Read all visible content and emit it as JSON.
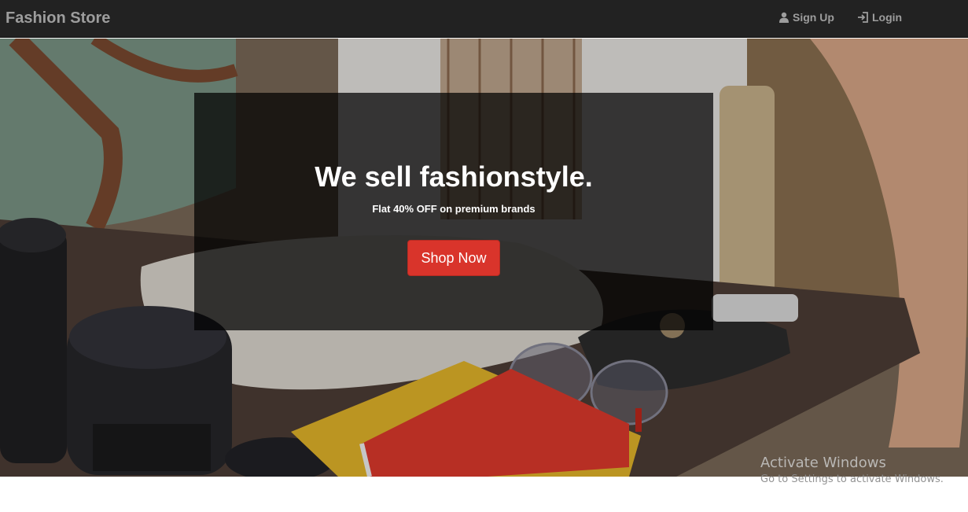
{
  "navbar": {
    "brand": "Fashion Store",
    "signup_label": "Sign Up",
    "login_label": "Login",
    "signup_icon": "user-icon",
    "login_icon": "log-in-icon"
  },
  "hero": {
    "title": "We sell fashionstyle.",
    "subtitle": "Flat 40% OFF on premium brands",
    "button_label": "Shop Now",
    "accent_color": "#d9342b"
  },
  "watermark": {
    "title": "Activate Windows",
    "subtitle": "Go to Settings to activate Windows."
  }
}
